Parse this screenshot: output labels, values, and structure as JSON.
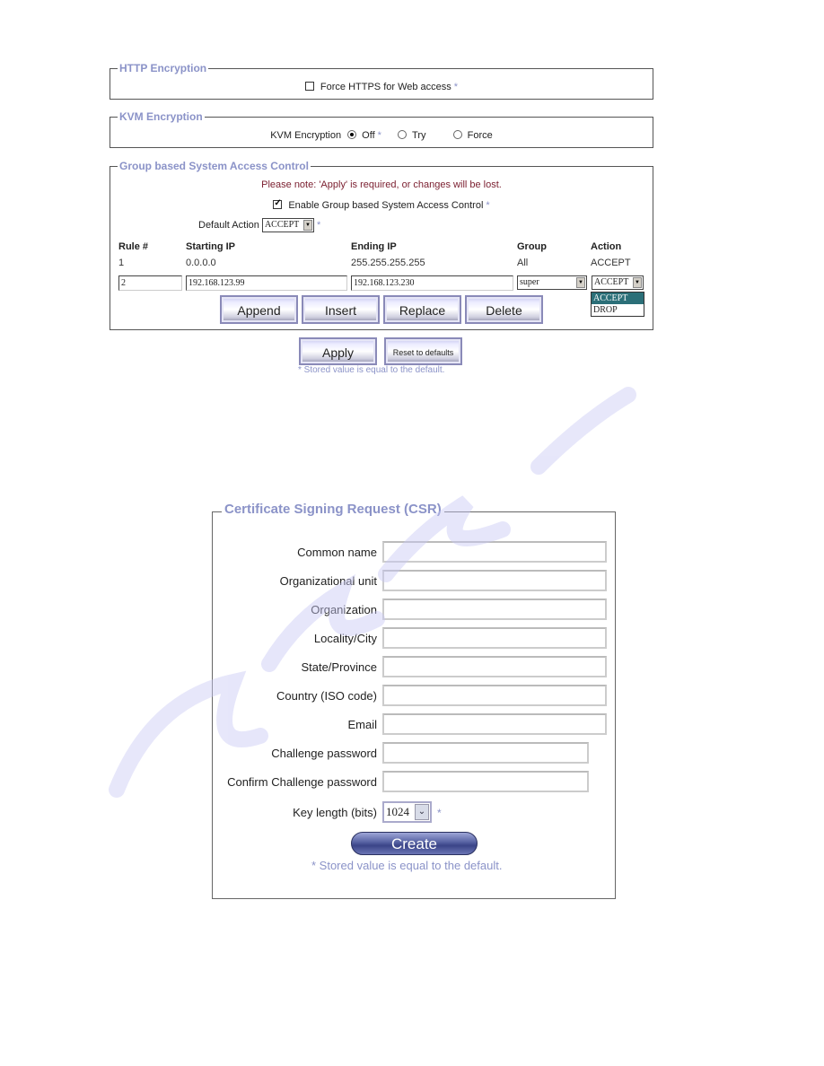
{
  "http_encryption": {
    "legend": "HTTP Encryption",
    "force_https_label": "Force HTTPS for Web access",
    "force_https_checked": false,
    "star": "*"
  },
  "kvm_encryption": {
    "legend": "KVM Encryption",
    "label": "KVM Encryption",
    "options": [
      {
        "label": "Off",
        "selected": true,
        "star": "*"
      },
      {
        "label": "Try",
        "selected": false
      },
      {
        "label": "Force",
        "selected": false
      }
    ]
  },
  "access_control": {
    "legend": "Group based System Access Control",
    "note": "Please note: 'Apply' is required, or changes will be lost.",
    "enable_label": "Enable Group based System Access Control",
    "enable_checked": true,
    "star": "*",
    "default_action_label": "Default Action",
    "default_action_value": "ACCEPT",
    "columns": [
      "Rule #",
      "Starting IP",
      "Ending IP",
      "Group",
      "Action"
    ],
    "rows": [
      {
        "rule": "1",
        "start_ip": "0.0.0.0",
        "end_ip": "255.255.255.255",
        "group": "All",
        "action": "ACCEPT"
      }
    ],
    "edit_row": {
      "rule": "2",
      "start_ip": "192.168.123.99",
      "end_ip": "192.168.123.230",
      "group": "super",
      "action": "ACCEPT"
    },
    "action_dropdown_options": [
      "ACCEPT",
      "DROP"
    ],
    "action_dropdown_highlighted": "ACCEPT",
    "buttons": {
      "append": "Append",
      "insert": "Insert",
      "replace": "Replace",
      "delete": "Delete"
    }
  },
  "bottom_actions": {
    "apply": "Apply",
    "reset": "Reset to defaults",
    "footnote": "* Stored value is equal to the default."
  },
  "csr": {
    "legend": "Certificate Signing Request (CSR)",
    "fields": [
      {
        "label": "Common name",
        "value": ""
      },
      {
        "label": "Organizational unit",
        "value": ""
      },
      {
        "label": "Organization",
        "value": ""
      },
      {
        "label": "Locality/City",
        "value": ""
      },
      {
        "label": "State/Province",
        "value": ""
      },
      {
        "label": "Country (ISO code)",
        "value": ""
      },
      {
        "label": "Email",
        "value": ""
      },
      {
        "label": "Challenge password",
        "value": ""
      },
      {
        "label": "Confirm Challenge password",
        "value": ""
      }
    ],
    "key_length_label": "Key length (bits)",
    "key_length_value": "1024",
    "star": "*",
    "create_button": "Create",
    "footnote": "* Stored value is equal to the default."
  },
  "colors": {
    "legend": "#8b93c8",
    "note": "#7a1d2e",
    "dropdown_highlight": "#2b6f78",
    "create_button": "#3a4488"
  }
}
